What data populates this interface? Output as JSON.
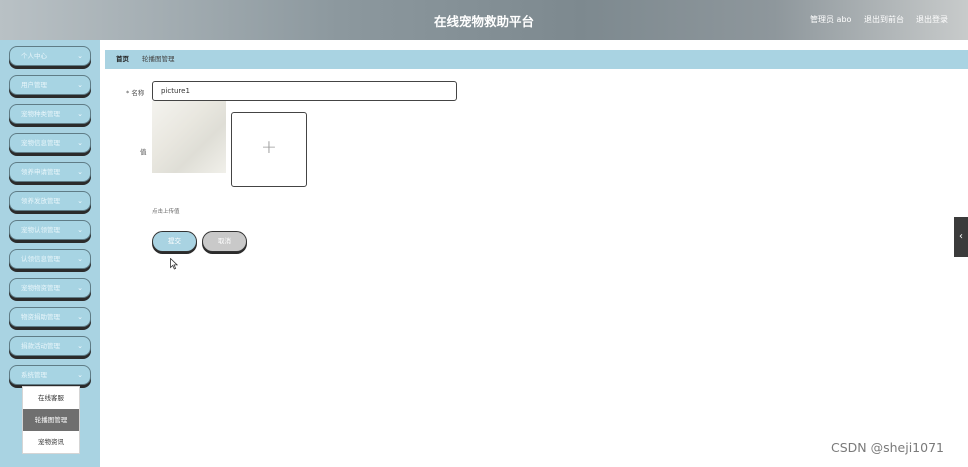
{
  "header": {
    "title": "在线宠物救助平台",
    "admin_label": "管理员 abo",
    "frontend_link": "退出到前台",
    "logout_link": "退出登录"
  },
  "sidebar": {
    "items": [
      {
        "label": "个人中心"
      },
      {
        "label": "用户管理"
      },
      {
        "label": "宠物种类管理"
      },
      {
        "label": "宠物信息管理"
      },
      {
        "label": "领养申请管理"
      },
      {
        "label": "领养发放管理"
      },
      {
        "label": "宠物认领管理"
      },
      {
        "label": "认领信息管理"
      },
      {
        "label": "宠物物资管理"
      },
      {
        "label": "物资捐助管理"
      },
      {
        "label": "捐款活动管理"
      },
      {
        "label": "系统管理"
      }
    ],
    "chevron": "⌄",
    "submenu": [
      {
        "label": "在线客服"
      },
      {
        "label": "轮播图管理"
      },
      {
        "label": "宠物资讯"
      }
    ]
  },
  "breadcrumb": {
    "home": "首页",
    "current": "轮播图管理"
  },
  "form": {
    "name_label": "* 名称",
    "name_value": "picture1",
    "image_label": "值",
    "upload_plus": "+",
    "upload_hint": "点击上传值",
    "submit_label": "提交",
    "cancel_label": "取消"
  },
  "side_tab": {
    "icon": "chevron-left-icon",
    "glyph": "‹"
  },
  "watermark": "CSDN @sheji1071"
}
